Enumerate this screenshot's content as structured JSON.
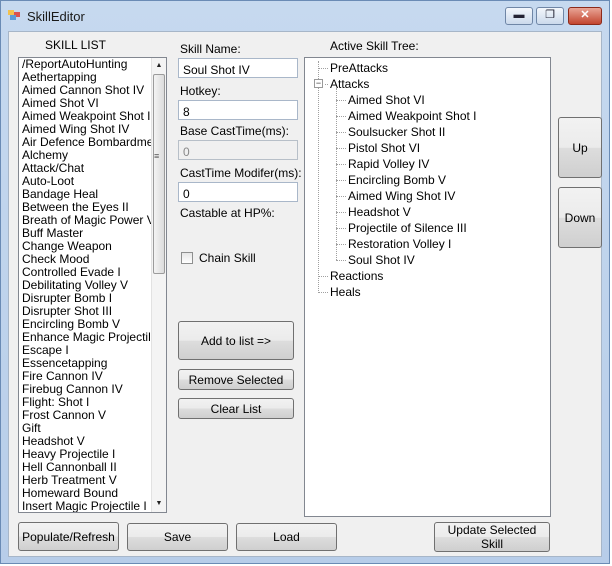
{
  "window": {
    "title": "SkillEditor"
  },
  "captions": {
    "minimize": "▬",
    "maximize": "❐",
    "close": "✕"
  },
  "skill_list": {
    "label": "SKILL LIST",
    "items": [
      "/ReportAutoHunting",
      "Aethertapping",
      "Aimed Cannon Shot IV",
      "Aimed Shot VI",
      "Aimed Weakpoint Shot I",
      "Aimed Wing Shot IV",
      "Air Defence Bombardment",
      "Alchemy",
      "Attack/Chat",
      "Auto-Loot",
      "Bandage Heal",
      "Between the Eyes II",
      "Breath of Magic Power V",
      "Buff Master",
      "Change Weapon",
      "Check Mood",
      "Controlled Evade I",
      "Debilitating Volley V",
      "Disrupter Bomb I",
      "Disrupter Shot III",
      "Encircling Bomb V",
      "Enhance Magic Projectile I",
      "Escape I",
      "Essencetapping",
      "Fire Cannon IV",
      "Firebug Cannon IV",
      "Flight: Shot I",
      "Frost Cannon V",
      "Gift",
      "Headshot V",
      "Heavy Projectile I",
      "Hell Cannonball II",
      "Herb Treatment V",
      "Homeward Bound",
      "Insert Magic Projectile I"
    ]
  },
  "form": {
    "skill_name_label": "Skill Name:",
    "skill_name_value": "Soul Shot IV",
    "hotkey_label": "Hotkey:",
    "hotkey_value": "8",
    "base_cast_label": "Base CastTime(ms):",
    "base_cast_value": "0",
    "cast_modifier_label": "CastTime Modifer(ms):",
    "cast_modifier_value": "0",
    "castable_label": "Castable at HP%:",
    "chain_skill_label": "Chain Skill",
    "chain_skill_checked": false
  },
  "buttons": {
    "add_to_list": "Add to list =>",
    "remove_selected": "Remove Selected",
    "clear_list": "Clear List",
    "up": "Up",
    "down": "Down",
    "populate_refresh": "Populate/Refresh",
    "save": "Save",
    "load": "Load",
    "update_selected": "Update Selected Skill"
  },
  "tree": {
    "label": "Active Skill Tree:",
    "root_nodes": [
      "PreAttacks",
      "Attacks",
      "Reactions",
      "Heals"
    ],
    "attacks_children": [
      "Aimed Shot VI",
      "Aimed Weakpoint Shot I",
      "Soulsucker Shot II",
      "Pistol Shot VI",
      "Rapid Volley IV",
      "Encircling Bomb V",
      "Aimed Wing Shot IV",
      "Headshot V",
      "Projectile of Silence III",
      "Restoration Volley I",
      "Soul Shot IV"
    ]
  }
}
